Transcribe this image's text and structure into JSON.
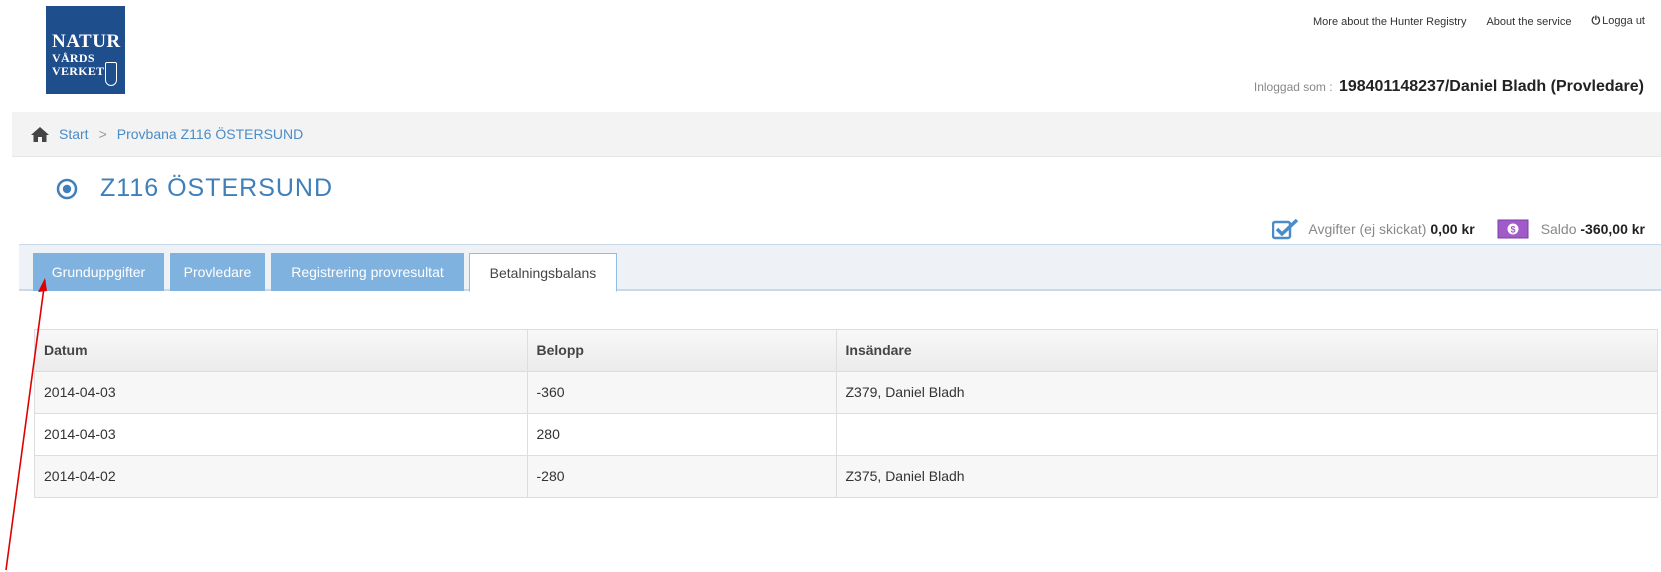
{
  "logo": {
    "line1": "NATUR",
    "line2": "VÅRDS",
    "line3": "VERKET"
  },
  "topnav": {
    "more_about": "More about the Hunter Registry",
    "about_service": "About the service",
    "logout": "Logga ut"
  },
  "user": {
    "label": "Inloggad som :",
    "name": "198401148237/Daniel Bladh (Provledare)"
  },
  "breadcrumb": {
    "start": "Start",
    "separator": ">",
    "current": "Provbana Z116 ÖSTERSUND"
  },
  "page": {
    "title": "Z116 ÖSTERSUND"
  },
  "summary": {
    "fees_label": "Avgifter (ej skickat)",
    "fees_value": "0,00 kr",
    "balance_label": "Saldo",
    "balance_value": "-360,00 kr"
  },
  "tabs": [
    {
      "label": "Grunduppgifter"
    },
    {
      "label": "Provledare"
    },
    {
      "label": "Registrering provresultat"
    },
    {
      "label": "Betalningsbalans"
    }
  ],
  "table": {
    "headers": [
      "Datum",
      "Belopp",
      "Insändare"
    ],
    "rows": [
      [
        "2014-04-03",
        "-360",
        "Z379, Daniel Bladh"
      ],
      [
        "2014-04-03",
        "280",
        ""
      ],
      [
        "2014-04-02",
        "-280",
        "Z375, Daniel Bladh"
      ]
    ]
  },
  "colors": {
    "accent": "#4a8cc7",
    "tab_fill": "#7fb2de",
    "logo_bg": "#1f4e8c",
    "annotation": "#e00000"
  }
}
